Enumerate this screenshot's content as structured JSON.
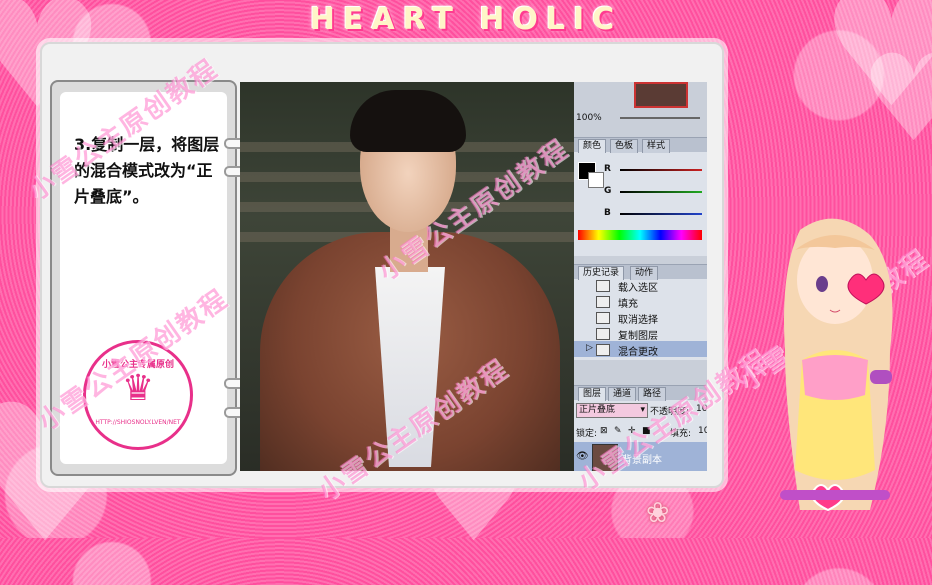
{
  "brand": {
    "title": "HEART HOLIC"
  },
  "step": {
    "text": "3.复制一层，将图层的混合模式改为“正片叠底”。"
  },
  "stamp": {
    "top_text": "小雪公主专属原创",
    "icon": "crown-icon",
    "url": "HTTP://SHIOSNOLY.LVEN/NET"
  },
  "watermark": {
    "text": "小雪公主原创教程"
  },
  "psd": {
    "zoom": "100%",
    "color_tabs": [
      "颜色",
      "色板",
      "样式"
    ],
    "sliders": [
      {
        "label": "R",
        "color": "#cc2222"
      },
      {
        "label": "G",
        "color": "#22aa22"
      },
      {
        "label": "B",
        "color": "#2244cc"
      }
    ],
    "history_tabs": [
      "历史记录",
      "动作"
    ],
    "history": [
      {
        "label": "载入选区",
        "selected": false
      },
      {
        "label": "填充",
        "selected": false
      },
      {
        "label": "取消选择",
        "selected": false
      },
      {
        "label": "复制图层",
        "selected": false
      },
      {
        "label": "混合更改",
        "selected": true
      }
    ],
    "layer_tabs": [
      "图层",
      "通道",
      "路径"
    ],
    "blend_mode": "正片叠底",
    "opacity_label": "不透明度:",
    "opacity_value": "10",
    "lock_label": "锁定:",
    "fill_label": "填充:",
    "fill_value": "10",
    "layer_name": "背景副本"
  }
}
